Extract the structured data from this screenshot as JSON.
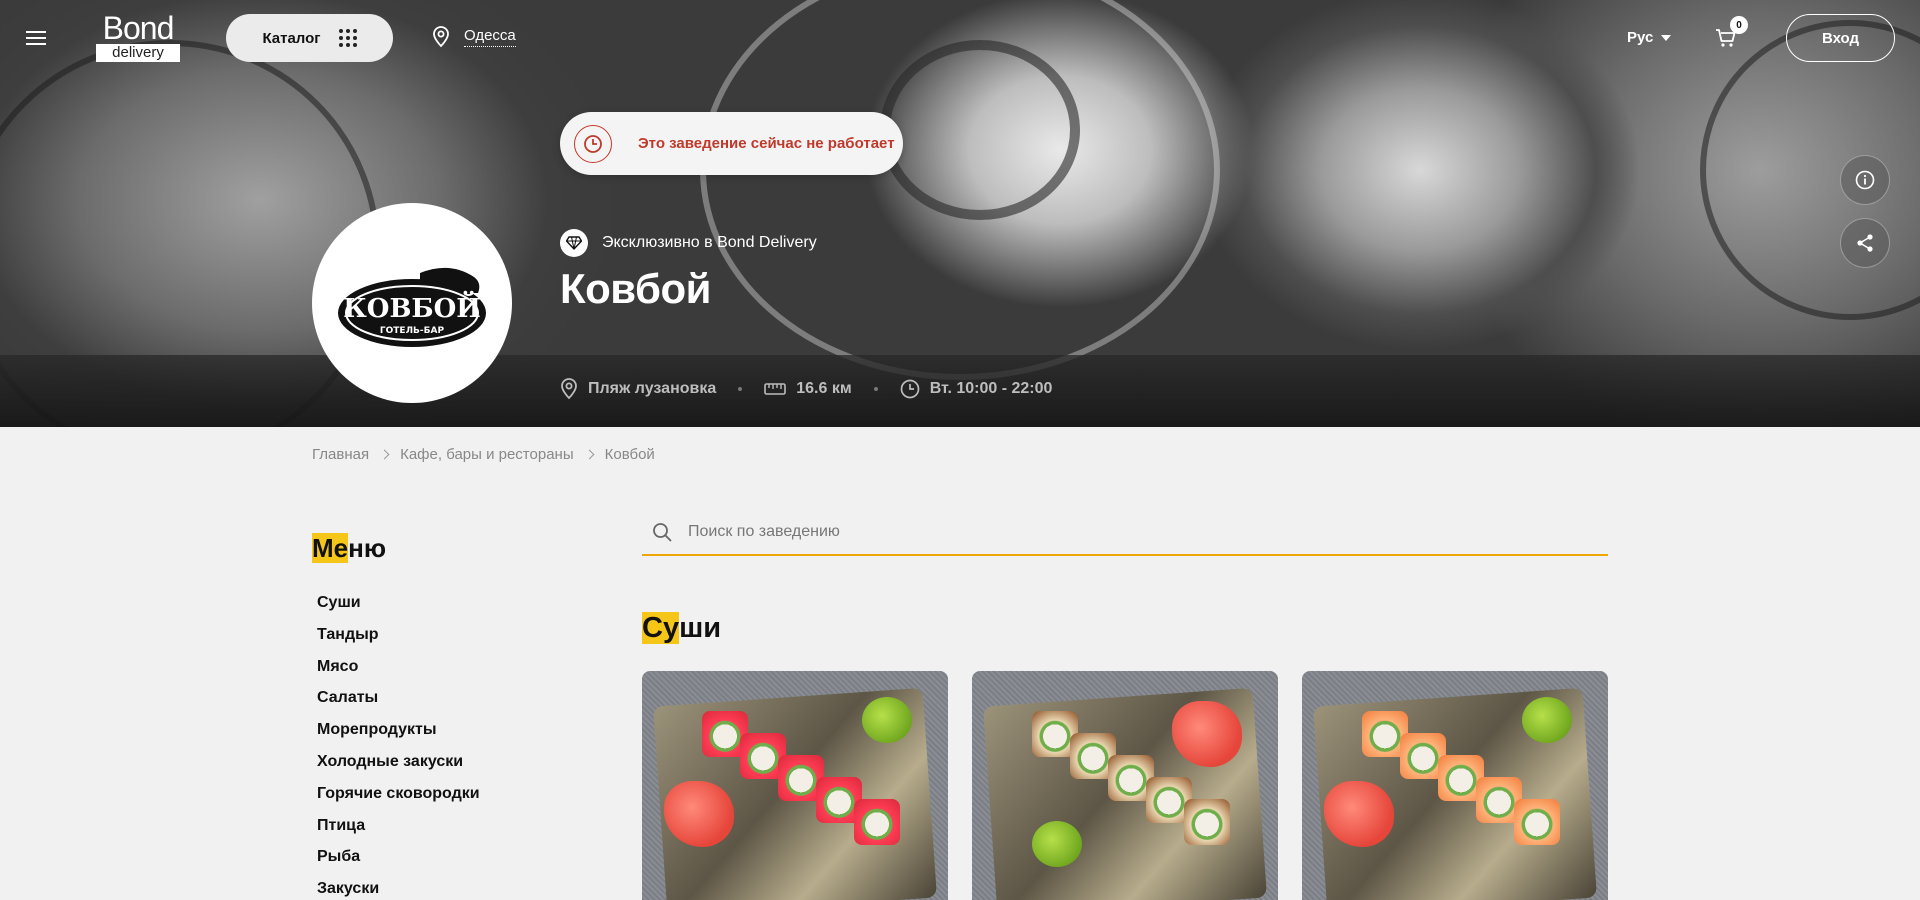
{
  "header": {
    "logo_top": "Bond",
    "logo_bottom": "delivery",
    "catalog_label": "Каталог",
    "city": "Одесса",
    "language": "Рус",
    "cart_count": "0",
    "login_label": "Вход"
  },
  "venue": {
    "status_notice": "Это заведение сейчас не работает",
    "exclusive_label": "Эксклюзивно в Bond Delivery",
    "name": "Ковбой",
    "logo_text": "КОВБОЙ",
    "logo_subtext": "ГОТЕЛЬ-БАР",
    "location": "Пляж лузановка",
    "distance": "16.6 км",
    "hours": "Вт. 10:00 - 22:00"
  },
  "breadcrumb": {
    "items": [
      "Главная",
      "Кафе, бары и рестораны",
      "Ковбой"
    ]
  },
  "menu": {
    "title_highlight": "Ме",
    "title_rest": "ню",
    "items": [
      "Суши",
      "Тандыр",
      "Мясо",
      "Салаты",
      "Морепродукты",
      "Холодные закуски",
      "Горячие сковородки",
      "Птица",
      "Рыба",
      "Закуски"
    ]
  },
  "search": {
    "placeholder": "Поиск по заведению"
  },
  "section": {
    "title_highlight": "Су",
    "title_rest": "ши"
  },
  "products": [
    {
      "name": "product-card-red-roll",
      "roll_color": "#d9283a",
      "topping_color": "#ff3d55"
    },
    {
      "name": "product-card-eel-roll",
      "roll_color": "#8a4a1f",
      "topping_color": "#e9d6b0"
    },
    {
      "name": "product-card-salmon-roll",
      "roll_color": "#f07a3a",
      "topping_color": "#ffb37a"
    }
  ],
  "colors": {
    "accent": "#f5c518",
    "search_underline": "#f0a500",
    "closed_status": "#c0392b"
  }
}
